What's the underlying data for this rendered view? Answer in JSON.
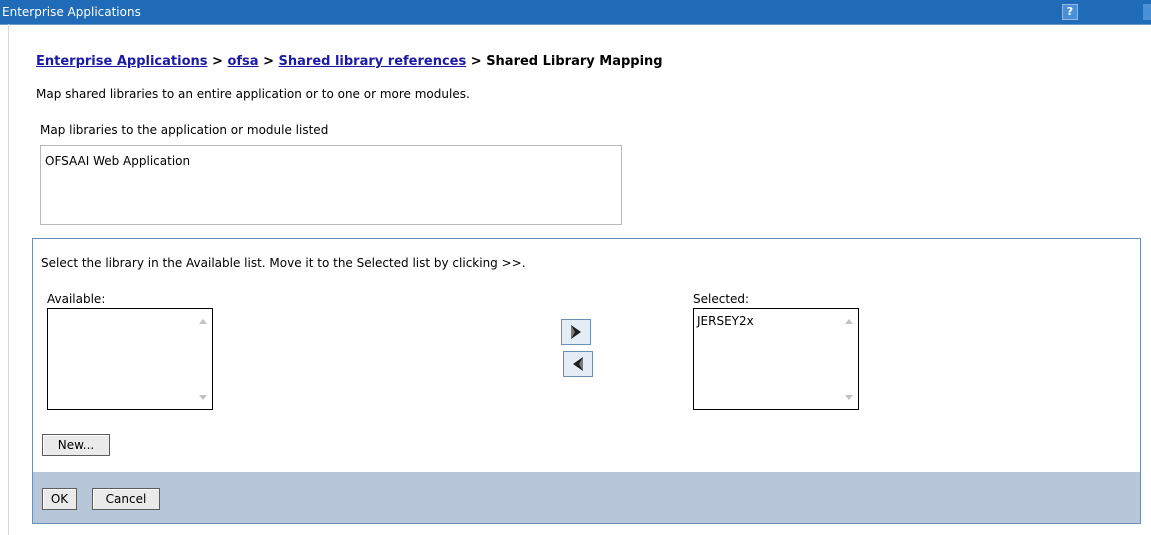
{
  "window": {
    "title": "Enterprise Applications",
    "help_label": "?"
  },
  "breadcrumb": {
    "link1": "Enterprise Applications",
    "sep1": " > ",
    "link2": "ofsa",
    "sep2": " > ",
    "link3": "Shared library references",
    "sep3": " > ",
    "current": "Shared Library Mapping"
  },
  "description": "Map shared libraries to an entire application or to one or more modules.",
  "module_section": {
    "label": "Map libraries to the application or module listed",
    "items": [
      "OFSAAI Web Application"
    ]
  },
  "library_panel": {
    "instruction": "Select the library in the Available list. Move it to the Selected list by clicking >>.",
    "available_label": "Available:",
    "selected_label": "Selected:",
    "available_items": [],
    "selected_items": [
      "JERSEY2x"
    ],
    "new_button": "New..."
  },
  "footer": {
    "ok_button": "OK",
    "cancel_button": "Cancel"
  },
  "colors": {
    "titlebar": "#1f6bb8",
    "link": "#1a1aa6",
    "footer": "#b7c7d9"
  }
}
